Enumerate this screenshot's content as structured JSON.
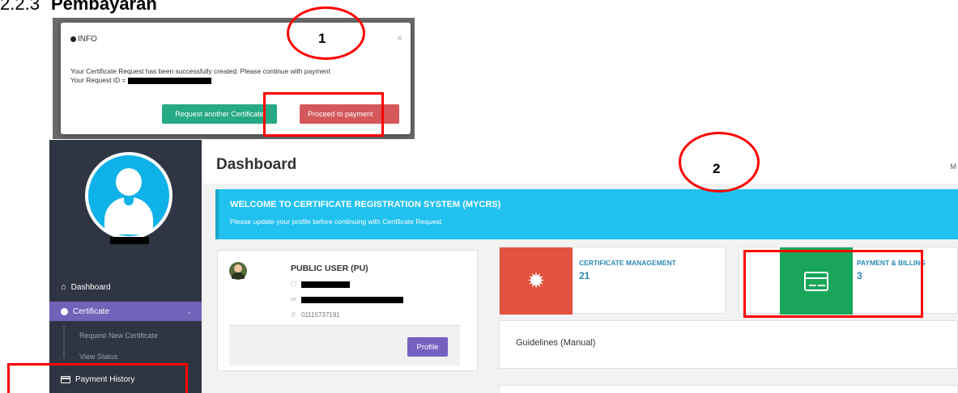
{
  "doc": {
    "section_number": "2.2.3",
    "section_title": "Pembayaran"
  },
  "modal": {
    "title": "INFO",
    "close": "×",
    "message_line1": "Your Certificate Request has been successfully created. Please continue with payment",
    "message_line2_prefix": "Your Request ID = ",
    "request_another_label": "Request another Certificate",
    "proceed_label": "Proceed to payment"
  },
  "sidebar": {
    "items": [
      {
        "label": "Dashboard",
        "icon": "home-icon"
      },
      {
        "label": "Certificate",
        "icon": "circle-icon",
        "chevron": "⌄"
      },
      {
        "label": "Request New Certificate"
      },
      {
        "label": "View Status"
      },
      {
        "label": "Payment History",
        "icon": "credit-card-icon"
      }
    ]
  },
  "main": {
    "title": "Dashboard",
    "top_right": "M",
    "banner": {
      "title": "WELCOME TO CERTIFICATE REGISTRATION SYSTEM (MYCRS)",
      "subtitle": "Please update your profile before continuing with Certificate Request"
    },
    "profile": {
      "role": "PUBLIC USER (PU)",
      "phone": "01115737191",
      "button_label": "Profile"
    },
    "stats": [
      {
        "label": "CERTIFICATE MANAGEMENT",
        "value": "21",
        "color": "#e2543f"
      },
      {
        "label": "PAYMENT & BILLING",
        "value": "3",
        "color": "#1aa65a"
      }
    ],
    "guidelines_label": "Guidelines (Manual)"
  },
  "annotations": {
    "step1": "1",
    "step2": "2",
    "color": "#ff0000"
  }
}
